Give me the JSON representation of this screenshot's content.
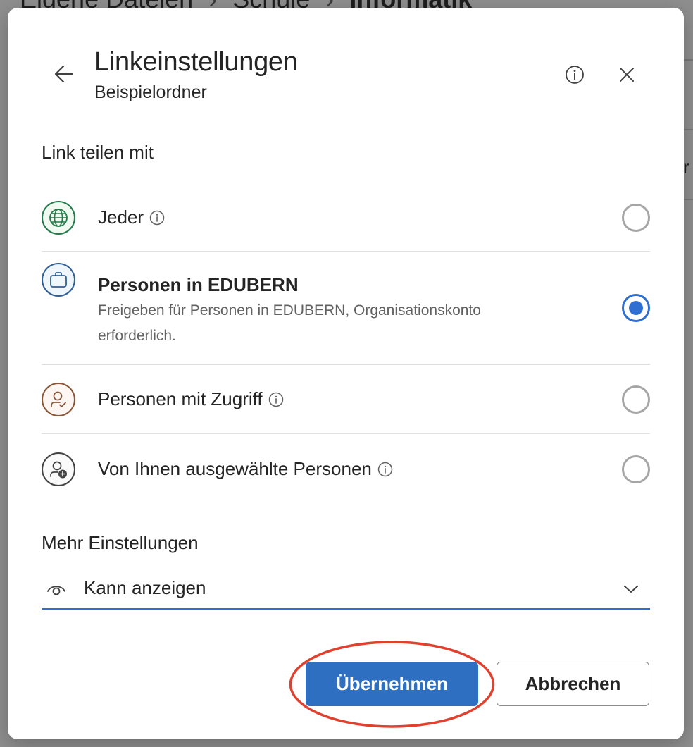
{
  "background": {
    "breadcrumb": [
      "Eigene Dateien",
      "Schule",
      "Informatik"
    ],
    "partial_text": "r"
  },
  "dialog": {
    "title": "Linkeinstellungen",
    "subtitle": "Beispielordner",
    "share_section_title": "Link teilen mit",
    "options": [
      {
        "label": "Jeder",
        "icon": "globe-icon",
        "has_info": true,
        "checked": false
      },
      {
        "label": "Personen in EDUBERN",
        "description": "Freigeben für Personen in EDUBERN, Organisationskonto erforderlich.",
        "icon": "briefcase-icon",
        "has_info": false,
        "checked": true
      },
      {
        "label": "Personen mit Zugriff",
        "icon": "person-check-icon",
        "has_info": true,
        "checked": false
      },
      {
        "label": "Von Ihnen ausgewählte Personen",
        "icon": "person-add-icon",
        "has_info": true,
        "checked": false
      }
    ],
    "more_section_title": "Mehr Einstellungen",
    "permission_dropdown": {
      "value": "Kann anzeigen",
      "icon": "eye-icon"
    },
    "apply_label": "Übernehmen",
    "cancel_label": "Abbrechen"
  },
  "colors": {
    "accent": "#2f6fd1",
    "apply_button": "#2f6fc2",
    "annotation_ellipse": "#e0412f"
  }
}
